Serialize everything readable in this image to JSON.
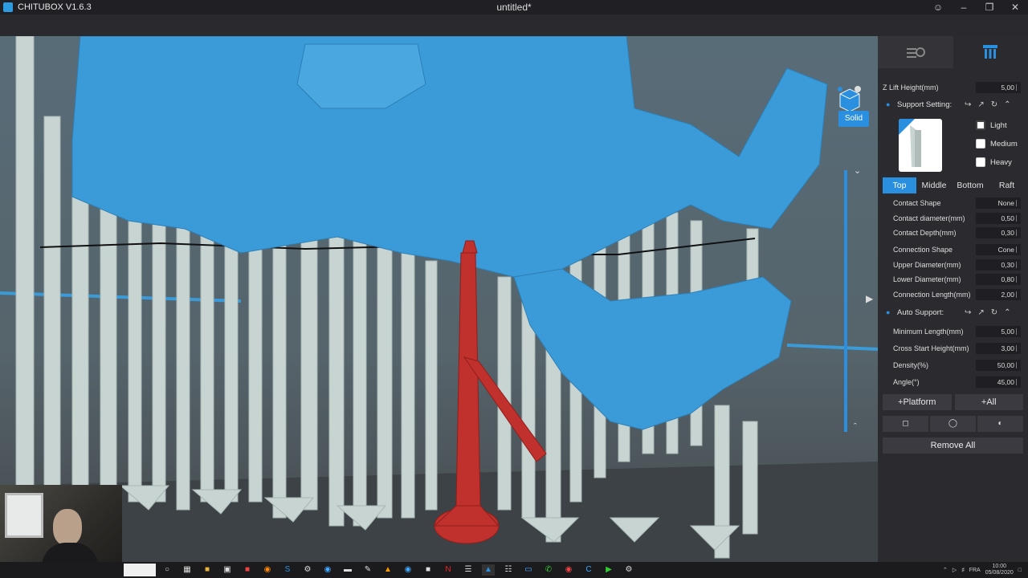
{
  "titlebar": {
    "app_name": "CHITUBOX V1.6.3",
    "doc_title": "untitled*",
    "controls": [
      "user-icon",
      "minimize-icon",
      "restore-icon",
      "close-icon"
    ]
  },
  "viewport": {
    "solid_label": "Solid",
    "colors": {
      "model": "#3b9bd8",
      "support": "#c8d4d2",
      "selected_support": "#c0302c",
      "accent": "#2b8fe0"
    }
  },
  "panel": {
    "z_lift": {
      "label": "Z Lift Height(mm)",
      "value": "5,00"
    },
    "support_setting_label": "Support Setting:",
    "weights": [
      "Light",
      "Medium",
      "Heavy"
    ],
    "tabs": [
      "Top",
      "Middle",
      "Bottom",
      "Raft"
    ],
    "active_tab": "Top",
    "params": [
      {
        "label": "Contact Shape",
        "value": "None"
      },
      {
        "label": "Contact diameter(mm)",
        "value": "0,50"
      },
      {
        "label": "Contact Depth(mm)",
        "value": "0,30"
      },
      {
        "label": "Connection Shape",
        "value": "Cone"
      },
      {
        "label": "Upper Diameter(mm)",
        "value": "0,30"
      },
      {
        "label": "Lower Diameter(mm)",
        "value": "0,80"
      },
      {
        "label": "Connection Length(mm)",
        "value": "2,00"
      }
    ],
    "auto_support_label": "Auto Support:",
    "auto_params": [
      {
        "label": "Minimum Length(mm)",
        "value": "5,00"
      },
      {
        "label": "Cross Start Height(mm)",
        "value": "3,00"
      },
      {
        "label": "Density(%)",
        "value": "50,00"
      },
      {
        "label": "Angle(°)",
        "value": "45,00"
      }
    ],
    "platform_button": "+Platform",
    "all_button": "+All",
    "remove_all": "Remove All"
  },
  "taskbar": {
    "lang": "FRA",
    "time": "10:00",
    "date": "05/08/2020"
  }
}
